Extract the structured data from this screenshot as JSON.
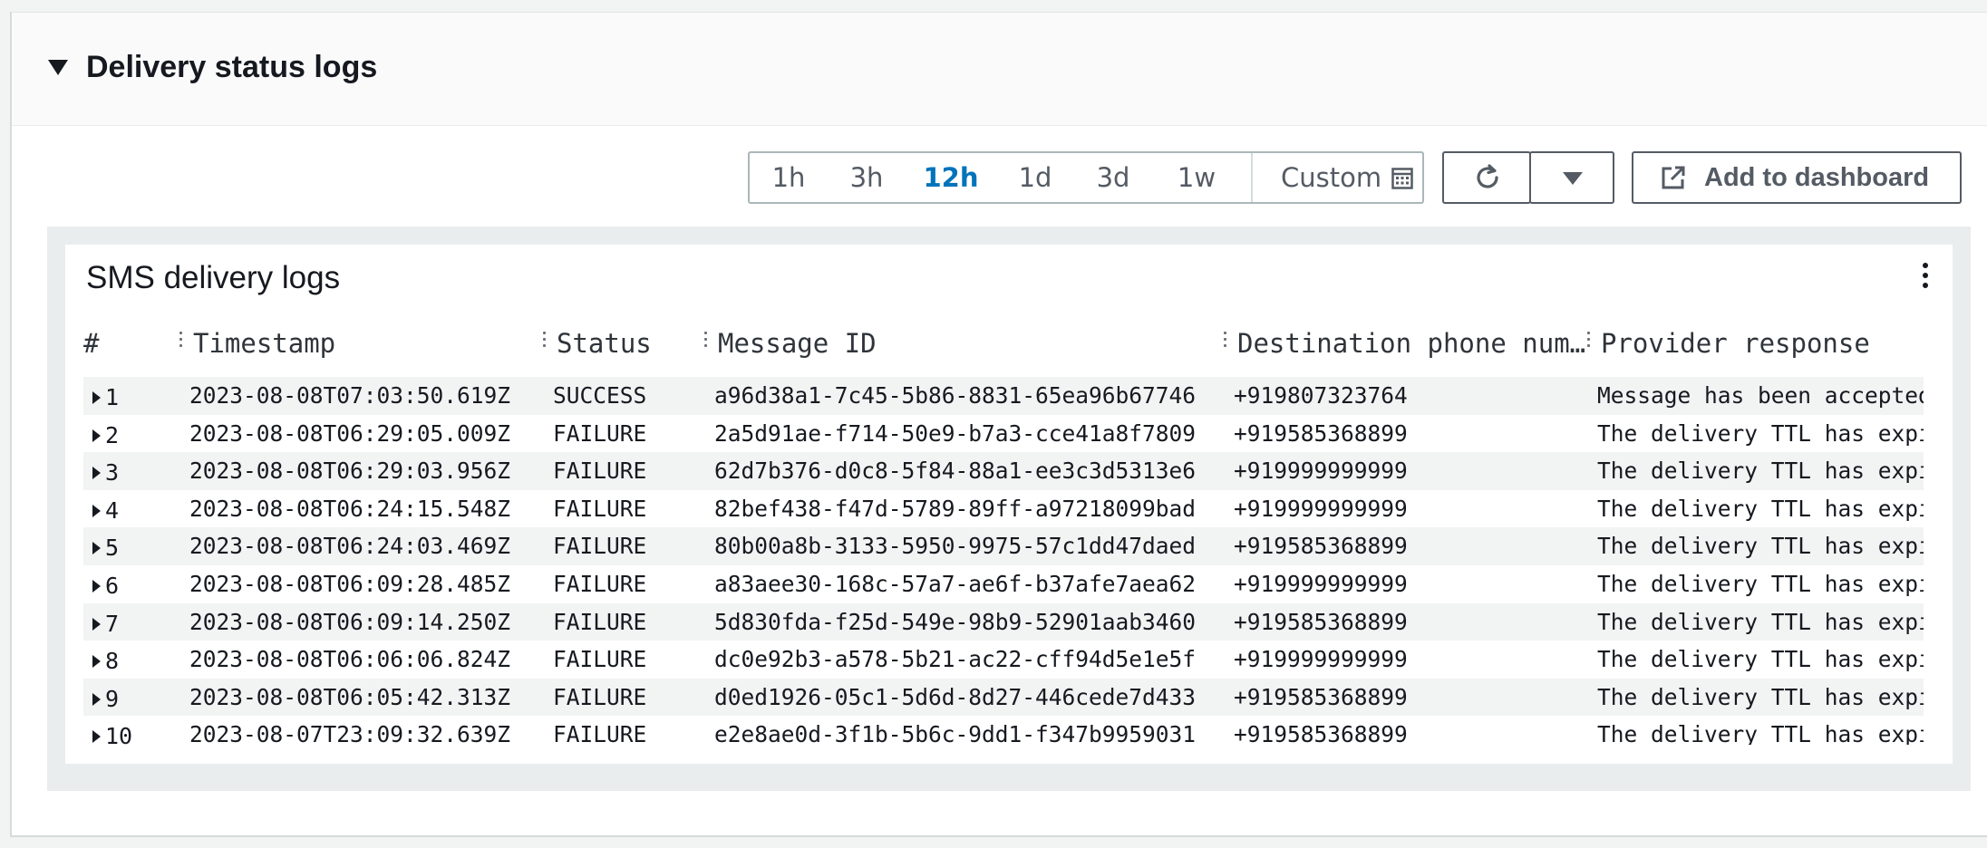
{
  "section": {
    "title": "Delivery status logs",
    "collapse_icon": "caret-down-icon"
  },
  "timerange": {
    "options": [
      "1h",
      "3h",
      "12h",
      "1d",
      "3d",
      "1w"
    ],
    "active": "12h",
    "custom_label": "Custom",
    "custom_icon": "calendar-icon"
  },
  "toolbar": {
    "refresh_icon": "refresh-icon",
    "dropdown_icon": "caret-down-icon",
    "add_dashboard_label": "Add to dashboard",
    "add_dashboard_icon": "external-link-icon"
  },
  "widget": {
    "title": "SMS delivery logs",
    "menu_icon": "kebab-menu-icon",
    "columns": [
      "#",
      "Timestamp",
      "Status",
      "Message ID",
      "Destination phone num…",
      "Provider response"
    ],
    "rows": [
      {
        "num": "1",
        "timestamp": "2023-08-08T07:03:50.619Z",
        "status": "SUCCESS",
        "message_id": "a96d38a1-7c45-5b86-8831-65ea96b67746",
        "phone": "+919807323764",
        "response": "Message has been accepted b"
      },
      {
        "num": "2",
        "timestamp": "2023-08-08T06:29:05.009Z",
        "status": "FAILURE",
        "message_id": "2a5d91ae-f714-50e9-b7a3-cce41a8f7809",
        "phone": "+919585368899",
        "response": "The delivery TTL has expir"
      },
      {
        "num": "3",
        "timestamp": "2023-08-08T06:29:03.956Z",
        "status": "FAILURE",
        "message_id": "62d7b376-d0c8-5f84-88a1-ee3c3d5313e6",
        "phone": "+919999999999",
        "response": "The delivery TTL has expir"
      },
      {
        "num": "4",
        "timestamp": "2023-08-08T06:24:15.548Z",
        "status": "FAILURE",
        "message_id": "82bef438-f47d-5789-89ff-a97218099bad",
        "phone": "+919999999999",
        "response": "The delivery TTL has expir"
      },
      {
        "num": "5",
        "timestamp": "2023-08-08T06:24:03.469Z",
        "status": "FAILURE",
        "message_id": "80b00a8b-3133-5950-9975-57c1dd47daed",
        "phone": "+919585368899",
        "response": "The delivery TTL has expir"
      },
      {
        "num": "6",
        "timestamp": "2023-08-08T06:09:28.485Z",
        "status": "FAILURE",
        "message_id": "a83aee30-168c-57a7-ae6f-b37afe7aea62",
        "phone": "+919999999999",
        "response": "The delivery TTL has expir"
      },
      {
        "num": "7",
        "timestamp": "2023-08-08T06:09:14.250Z",
        "status": "FAILURE",
        "message_id": "5d830fda-f25d-549e-98b9-52901aab3460",
        "phone": "+919585368899",
        "response": "The delivery TTL has expir"
      },
      {
        "num": "8",
        "timestamp": "2023-08-08T06:06:06.824Z",
        "status": "FAILURE",
        "message_id": "dc0e92b3-a578-5b21-ac22-cff94d5e1e5f",
        "phone": "+919999999999",
        "response": "The delivery TTL has expir"
      },
      {
        "num": "9",
        "timestamp": "2023-08-08T06:05:42.313Z",
        "status": "FAILURE",
        "message_id": "d0ed1926-05c1-5d6d-8d27-446cede7d433",
        "phone": "+919585368899",
        "response": "The delivery TTL has expir"
      },
      {
        "num": "10",
        "timestamp": "2023-08-07T23:09:32.639Z",
        "status": "FAILURE",
        "message_id": "e2e8ae0d-3f1b-5b6c-9dd1-f347b9959031",
        "phone": "+919585368899",
        "response": "The delivery TTL has expir"
      }
    ]
  },
  "colors": {
    "accent": "#0073bb",
    "page_bg": "#f2f3f3",
    "row_alt": "#f2f3f3"
  }
}
